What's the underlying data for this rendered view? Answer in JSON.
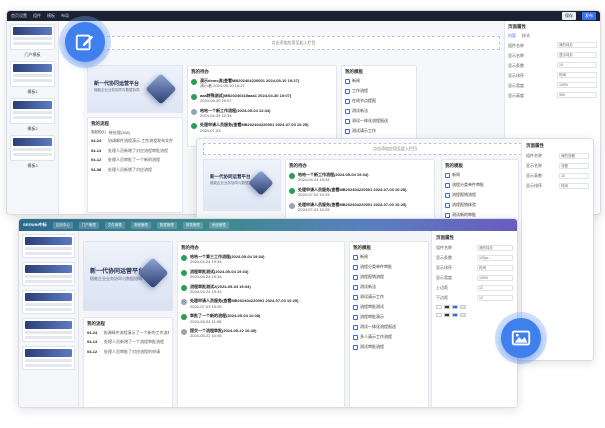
{
  "colors": {
    "accent": "#3f7fee",
    "topbar": "#1d2233",
    "success": "#2a9d5a"
  },
  "icons": {
    "edit": "edit-icon",
    "image": "image-icon"
  },
  "common": {
    "add_component_hint": "点击添加应用至此入栏目",
    "brand_title": "新一代协同运营平台",
    "brand_subtitle": "赋能企业业务协同与数据协同",
    "todo_title": "我的待办",
    "process_title": "我的流程",
    "my_template": "我的模板",
    "page_property": "页面属性"
  },
  "win_a": {
    "topbar": [
      "首页设置",
      "组件",
      "模板",
      "布局"
    ],
    "save": "保存",
    "publish": "发布",
    "side_labels": [
      "门户模板",
      "模板1",
      "模板2",
      "模板3"
    ],
    "tabs": [
      "发起的(1)",
      "待处理(266)"
    ],
    "todo_items": [
      {
        "title": "演示demo流(查看MB202404220001 2024-05-10 10:27)",
        "meta": "演示者 2024-05-10 10:27"
      },
      {
        "title": "aaa特殊测试(MB20240415aaa1 2024-04-30 10:07)",
        "meta": "2024-04-30 10:07"
      },
      {
        "title": "哈哈一个新工作流程(2024-05-04 12:34)",
        "meta": "2024-04-24 12:34"
      },
      {
        "title": "处理申请人员服务(查看MB202404220001 2024-07-03 10:25)",
        "meta": "2024-07-03"
      }
    ],
    "template_items": [
      "新闻",
      "工作流程",
      "在线节点提报",
      "测试新法",
      "测试一体化流程报送",
      "测试请示工作",
      "测试一下流程审批流程"
    ],
    "process_items": [
      {
        "date": "04-24",
        "time": "19:34",
        "text": "协调邮件流程演示 工作流程发布文件"
      },
      {
        "date": "04-14",
        "time": "14:22",
        "text": "处理人员新增了对应流程审批流程"
      },
      {
        "date": "04-12",
        "time": "10:03",
        "text": "处理人员审批了一个新的流程"
      },
      {
        "date": "04-08",
        "time": "16:45",
        "text": "处理人员新增了对应流程"
      }
    ],
    "right_tabs": [
      "内容",
      "样式"
    ],
    "right_fields": [
      {
        "label": "组件名称",
        "value": "我的待办"
      },
      {
        "label": "显示名称",
        "value": "显示待办"
      },
      {
        "label": "显示条数",
        "value": "10"
      },
      {
        "label": "显示排序",
        "value": "时间"
      },
      {
        "label": "显示宽度",
        "value": "100%"
      },
      {
        "label": "显示高度",
        "value": "300"
      }
    ]
  },
  "win_b": {
    "todo_items": [
      {
        "title": "哈哈一个新工作流程(2024-05-04 19:34)",
        "meta": "2024-04-24 19:34"
      },
      {
        "title": "处理申请人员服务(查看MB202404220001 2024-07-03 10:25)",
        "meta": "2024-07-03 10:25"
      },
      {
        "title": "处理申请人员服务(查看MB202404220001 2024-07-03 10:25)",
        "meta": "2024-07-03 10:25"
      }
    ],
    "list_items": [
      "新闻",
      "流程分类单件审批",
      "流程报销流程",
      "流程报销体验",
      "测试新的审批",
      "请示一下流程审批"
    ],
    "right_fields": [
      {
        "label": "组件名称",
        "value": "我的流程"
      },
      {
        "label": "显示名称",
        "value": "流程"
      },
      {
        "label": "显示条数",
        "value": "10"
      },
      {
        "label": "显示排序",
        "value": "时间"
      }
    ]
  },
  "win_c": {
    "brand": "SEEWIN中标",
    "tabs": [
      "应用中心",
      "门户管理",
      "文件管理",
      "流程管理",
      "数据管理",
      "报表管理",
      "系统管理"
    ],
    "todo_items": [
      {
        "title": "哈哈一个第三工作流程(2024-05-04 19:34)",
        "meta": "2024-04-24 19:34"
      },
      {
        "title": "流程审批测试(2024-05-04 19:34)",
        "meta": "2024-04-24 19:34"
      },
      {
        "title": "流程审批测试2(2024-05-04 19:34)",
        "meta": "2024-04-24 19:34"
      },
      {
        "title": "处理申请人员服务(查看MB202404220001 2024-07-03 10:25)",
        "meta": "2024-07-03 10:25"
      },
      {
        "title": "审批了一个新的流程(2024-05-04 11:08)",
        "meta": "2024-05-04 11:08"
      },
      {
        "title": "提交一个流程审批(2024-05-22 10:45)",
        "meta": "2024-05-22 10:45"
      }
    ],
    "process_items": [
      {
        "date": "04-24",
        "time": "10:34",
        "text": "协调邮件流程演示了一个新的工作流程"
      },
      {
        "date": "04-14",
        "time": "14:22",
        "text": "处理人员新增了一个流程审批流程"
      },
      {
        "date": "04-12",
        "time": "10:03",
        "text": "处理人员审批了对应流程的申请"
      }
    ],
    "list_items": [
      "新闻",
      "流程分类单件审批",
      "流程报销流程",
      "测试新法",
      "测试请示工作",
      "流程审批测试",
      "流程审批演示",
      "测试一体化流程报送",
      "多人请示工作流程",
      "测试审批流程"
    ],
    "right_fields": [
      {
        "label": "组件名称",
        "value": "我的待办"
      },
      {
        "label": "显示条数",
        "value": "100px"
      },
      {
        "label": "显示排序",
        "value": "时间"
      },
      {
        "label": "显示宽度",
        "value": "100%"
      },
      {
        "label": "上边距",
        "value": "12"
      },
      {
        "label": "下边距",
        "value": "12"
      }
    ]
  }
}
